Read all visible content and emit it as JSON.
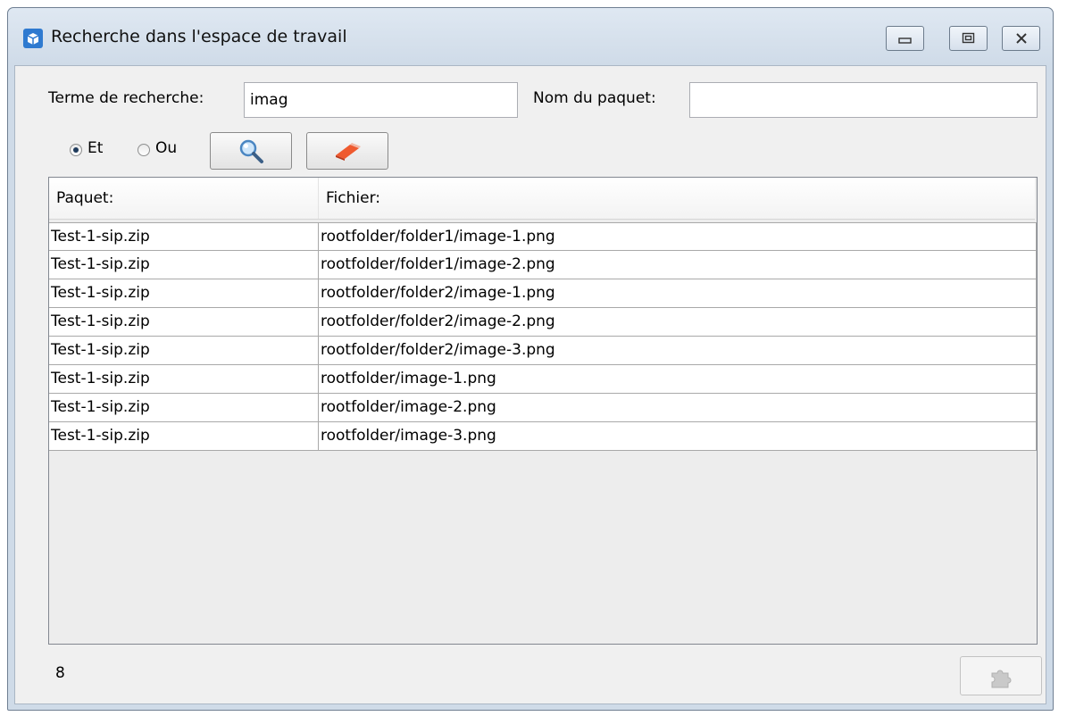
{
  "window": {
    "title": "Recherche dans l'espace de travail",
    "icon": "workspace-app-icon",
    "controls": {
      "minimize": "minimize-icon",
      "maximize": "maximize-icon",
      "close": "close-icon"
    }
  },
  "search": {
    "term_label": "Terme de recherche:",
    "term_value": "imag",
    "package_label": "Nom du paquet:",
    "package_value": "",
    "radio_and_label": "Et",
    "radio_or_label": "Ou",
    "selected_operator": "Et",
    "search_button_icon": "magnifier-icon",
    "clear_button_icon": "eraser-icon"
  },
  "table": {
    "columns": [
      "Paquet:",
      "Fichier:"
    ],
    "rows": [
      [
        "Test-1-sip.zip",
        "rootfolder/folder1/image-1.png"
      ],
      [
        "Test-1-sip.zip",
        "rootfolder/folder1/image-2.png"
      ],
      [
        "Test-1-sip.zip",
        "rootfolder/folder2/image-1.png"
      ],
      [
        "Test-1-sip.zip",
        "rootfolder/folder2/image-2.png"
      ],
      [
        "Test-1-sip.zip",
        "rootfolder/folder2/image-3.png"
      ],
      [
        "Test-1-sip.zip",
        "rootfolder/image-1.png"
      ],
      [
        "Test-1-sip.zip",
        "rootfolder/image-2.png"
      ],
      [
        "Test-1-sip.zip",
        "rootfolder/image-3.png"
      ]
    ]
  },
  "footer": {
    "result_count": "8",
    "export_button_icon": "export-puzzle-icon",
    "export_enabled": false
  },
  "colors": {
    "window_frame": "#cfdbe8",
    "client_bg": "#f0f0f0",
    "accent_icon": "#2f7ad0"
  }
}
